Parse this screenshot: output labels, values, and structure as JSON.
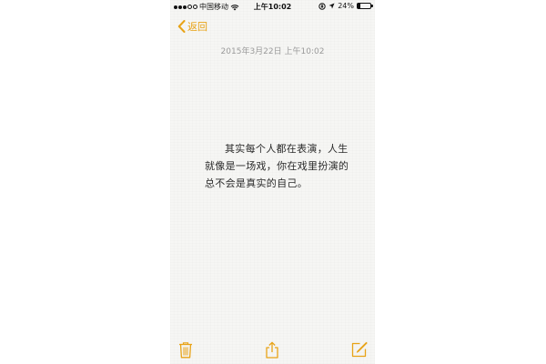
{
  "status_bar": {
    "carrier": "中国移动",
    "time": "上午10:02",
    "battery": "24%",
    "battery_level": 0.24
  },
  "nav": {
    "back_label": "返回"
  },
  "note": {
    "date": "2015年3月22日 上午10:02",
    "body": "其实每个人都在表演，人生就像是一场戏，你在戏里扮演的总不会是真实的自己。"
  },
  "toolbar": {
    "icons": [
      "trash-icon",
      "share-icon",
      "compose-icon"
    ]
  },
  "colors": {
    "accent": "#e8a317",
    "paper": "#f6f6f4",
    "date_text": "#9a9a9a"
  }
}
